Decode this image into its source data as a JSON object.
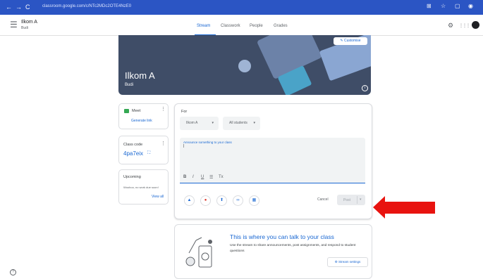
{
  "browser": {
    "url": "classroom.google.com/c/NTc2MDc2OTE4NzE0",
    "back": "←",
    "forward": "→",
    "reload": "C"
  },
  "appbar": {
    "menu_icon": "☰",
    "class_title": "Ilkom A",
    "class_subtitle": "Budi",
    "tabs": [
      "Stream",
      "Classwork",
      "People",
      "Grades"
    ],
    "icons": [
      "⚙",
      "⋮⋮⋮",
      ""
    ]
  },
  "banner": {
    "title": "Ilkom A",
    "subtitle": "Budi",
    "customise": "✎ Customise",
    "info_icon": "i"
  },
  "meet": {
    "label": "Meet",
    "link": "Generate link"
  },
  "class_code": {
    "label": "Class code",
    "code": "4pa7eix",
    "fullscreen_icon": "⛶"
  },
  "upcoming": {
    "label": "Upcoming",
    "text": "Woohoo, no work due soon!",
    "view_all": "View all"
  },
  "composer": {
    "for_label": "For",
    "class_select": "Ilkom A",
    "students_select": "All students",
    "placeholder": "Announce something to your class",
    "format_buttons": [
      "B",
      "I",
      "U",
      "☰",
      "Tx"
    ],
    "attach_icons": [
      "▲",
      "●",
      "⬆",
      "∞",
      "▦"
    ],
    "cancel": "Cancel",
    "post": "Post",
    "caret": "▾"
  },
  "talk": {
    "title": "This is where you can talk to your class",
    "description": "Use the stream to share announcements, post assignments, and respond to student questions",
    "stream_settings": "⚙ Stream settings"
  },
  "help_icon": "?",
  "colors": {
    "accent": "#1967d2",
    "browser_bar": "#2b55c4",
    "arrow": "#e8130f",
    "banner": "#3f4d67"
  }
}
